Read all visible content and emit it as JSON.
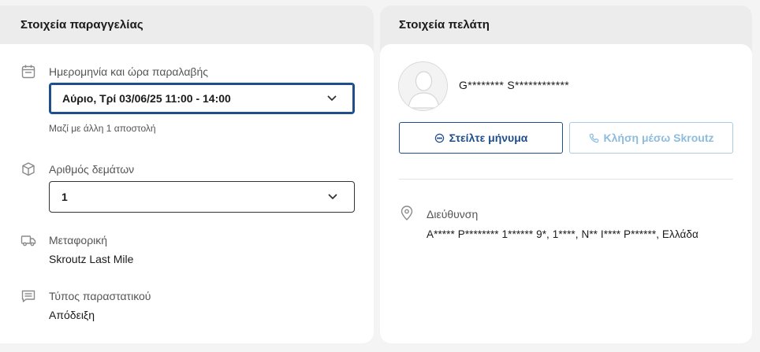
{
  "order": {
    "title": "Στοιχεία παραγγελίας",
    "pickup": {
      "icon": "calendar-icon",
      "label": "Ημερομηνία και ώρα παραλαβής",
      "selected": "Αύριο, Τρί 03/06/25 11:00 - 14:00",
      "hint": "Μαζί με άλλη 1 αποστολή"
    },
    "parcels": {
      "icon": "box-icon",
      "label": "Αριθμός δεμάτων",
      "selected": "1"
    },
    "carrier": {
      "icon": "truck-icon",
      "label": "Μεταφορική",
      "value": "Skroutz Last Mile"
    },
    "document": {
      "icon": "receipt-icon",
      "label": "Τύπος παραστατικού",
      "value": "Απόδειξη"
    }
  },
  "customer": {
    "title": "Στοιχεία πελάτη",
    "avatar_icon": "user-avatar-icon",
    "name": "G******** S************",
    "message_button": "Στείλτε μήνυμα",
    "call_button": "Κλήση μέσω Skroutz",
    "address": {
      "icon": "location-pin-icon",
      "label": "Διεύθυνση",
      "value": "A***** P******** 1****** 9*, 1****, N** I**** P******, Ελλάδα"
    }
  },
  "colors": {
    "accent": "#1f4e8c",
    "disabled_accent": "#8dbcdc",
    "panel_bg": "#ececec",
    "page_bg": "#f4f4f4"
  }
}
